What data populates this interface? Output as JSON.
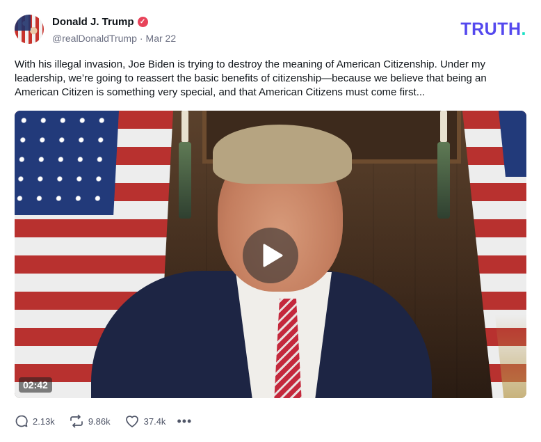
{
  "author": {
    "name": "Donald J. Trump",
    "handle": "@realDonaldTrump",
    "date": "Mar 22",
    "verified_icon": "verified-badge-icon"
  },
  "brand": {
    "logo_text": "TRUTH",
    "logo_dot": ".",
    "accent_color": "#5448ee",
    "dot_color": "#18e0c4"
  },
  "post": {
    "text": "With his illegal invasion, Joe Biden is trying to destroy the meaning of American Citizenship. Under my leadership, we’re going to reassert the basic benefits of citizenship—because we believe that being an American Citizen is something very special, and that American Citizens must come first..."
  },
  "video": {
    "duration": "02:42",
    "play_icon": "play-icon"
  },
  "actions": {
    "replies": "2.13k",
    "retruths": "9.86k",
    "likes": "37.4k",
    "more_icon": "more-dots-icon"
  }
}
